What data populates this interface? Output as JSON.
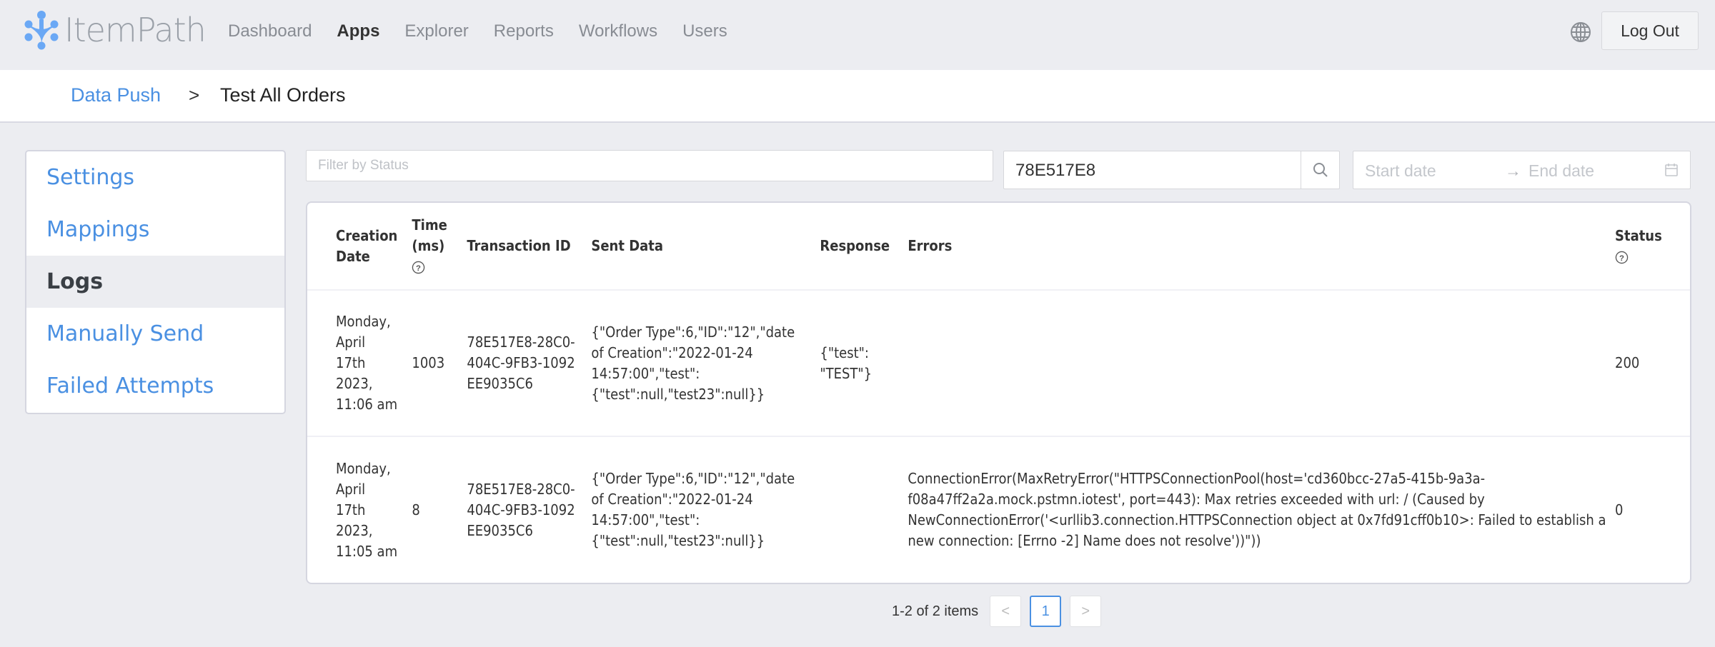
{
  "app": {
    "name": "ItemPath",
    "brand_color": "#4a90e2"
  },
  "nav": {
    "items": [
      {
        "label": "Dashboard",
        "active": false
      },
      {
        "label": "Apps",
        "active": true
      },
      {
        "label": "Explorer",
        "active": false
      },
      {
        "label": "Reports",
        "active": false
      },
      {
        "label": "Workflows",
        "active": false
      },
      {
        "label": "Users",
        "active": false
      }
    ],
    "globe_icon": "globe-icon",
    "logout_label": "Log Out"
  },
  "breadcrumb": {
    "parent": "Data Push",
    "separator": ">",
    "current": "Test All Orders"
  },
  "sidebar": {
    "items": [
      {
        "label": "Settings",
        "active": false
      },
      {
        "label": "Mappings",
        "active": false
      },
      {
        "label": "Logs",
        "active": true
      },
      {
        "label": "Manually Send",
        "active": false
      },
      {
        "label": "Failed Attempts",
        "active": false
      }
    ]
  },
  "filters": {
    "status_placeholder": "Filter by Status",
    "search_value": "78E517E8",
    "start_date_placeholder": "Start date",
    "date_arrow": "→",
    "end_date_placeholder": "End date"
  },
  "table": {
    "headers": {
      "creation_date": "Creation Date",
      "time_ms": "Time (ms)",
      "transaction_id": "Transaction ID",
      "sent_data": "Sent Data",
      "response": "Response",
      "errors": "Errors",
      "status": "Status"
    },
    "rows": [
      {
        "creation_date": "Monday, April 17th 2023, 11:06 am",
        "time_ms": "1003",
        "transaction_id": "78E517E8-28C0-404C-9FB3-1092EE9035C6",
        "sent_data": "{\"Order Type\":6,\"ID\":\"12\",\"date of Creation\":\"2022-01-24 14:57:00\",\"test\":{\"test\":null,\"test23\":null}}",
        "response": "{\"test\": \"TEST\"}",
        "errors": "",
        "status": "200"
      },
      {
        "creation_date": "Monday, April 17th 2023, 11:05 am",
        "time_ms": "8",
        "transaction_id": "78E517E8-28C0-404C-9FB3-1092EE9035C6",
        "sent_data": "{\"Order Type\":6,\"ID\":\"12\",\"date of Creation\":\"2022-01-24 14:57:00\",\"test\":{\"test\":null,\"test23\":null}}",
        "response": "",
        "errors": "ConnectionError(MaxRetryError(\"HTTPSConnectionPool(host='cd360bcc-27a5-415b-9a3a-f08a47ff2a2a.mock.pstmn.iotest', port=443): Max retries exceeded with url: / (Caused by NewConnectionError('<urllib3.connection.HTTPSConnection object at 0x7fd91cff0b10>: Failed to establish a new connection: [Errno -2] Name does not resolve'))\"))",
        "status": "0"
      }
    ]
  },
  "pagination": {
    "summary": "1-2 of 2 items",
    "prev": "<",
    "current_page": "1",
    "next": ">"
  }
}
